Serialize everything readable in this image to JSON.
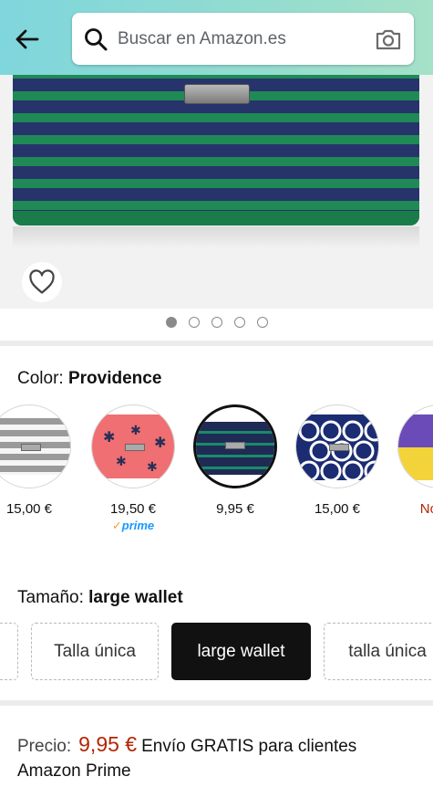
{
  "header": {
    "search_placeholder": "Buscar en Amazon.es"
  },
  "gallery": {
    "total_images": 5,
    "active_index": 0
  },
  "color": {
    "label": "Color:",
    "selected": "Providence",
    "options": [
      {
        "price": "15,00 €",
        "pattern": "grey-stripe",
        "prime": false,
        "available": true
      },
      {
        "price": "19,50 €",
        "pattern": "pink-palm",
        "prime": true,
        "available": true
      },
      {
        "price": "9,95 €",
        "pattern": "navy-stripe",
        "prime": false,
        "available": true,
        "selected": true
      },
      {
        "price": "15,00 €",
        "pattern": "navy-lattice",
        "prime": false,
        "available": true
      },
      {
        "price": "No dis",
        "pattern": "comic",
        "prime": false,
        "available": false
      }
    ],
    "prime_badge": "prime"
  },
  "size": {
    "label": "Tamaño:",
    "selected": "large wallet",
    "options": [
      "Talla única",
      "large wallet",
      "talla única"
    ]
  },
  "price": {
    "label": "Precio:",
    "value": "9,95 €",
    "shipping": "Envío GRATIS para clientes Amazon Prime"
  },
  "colors": {
    "header_gradient_start": "#7fd6dc",
    "price_red": "#b12704",
    "prime_blue": "#1a98ff"
  }
}
